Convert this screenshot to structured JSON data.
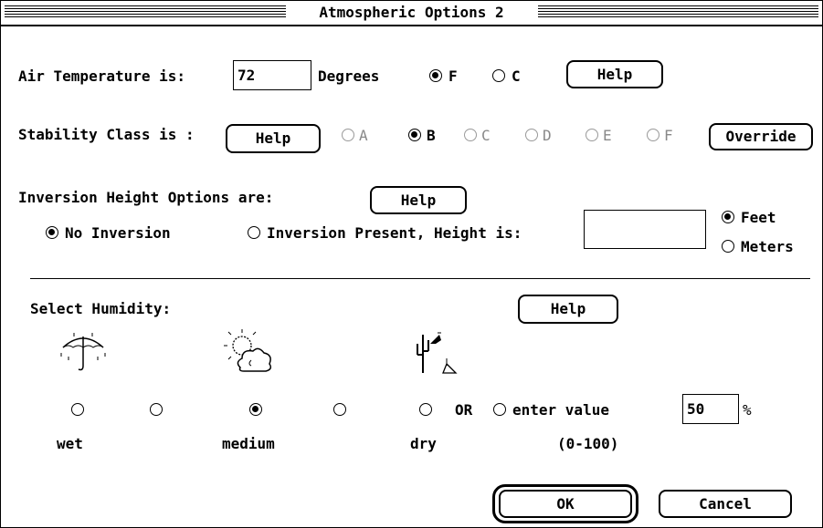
{
  "window": {
    "title": "Atmospheric Options 2"
  },
  "air_temperature": {
    "label": "Air Temperature is:",
    "value": "72",
    "units_label": "Degrees",
    "unit_options": [
      "F",
      "C"
    ],
    "selected_unit": "F",
    "help_label": "Help"
  },
  "stability": {
    "label": "Stability Class is :",
    "help_label": "Help",
    "classes": [
      "A",
      "B",
      "C",
      "D",
      "E",
      "F"
    ],
    "selected": "B",
    "override_label": "Override"
  },
  "inversion": {
    "label": "Inversion Height Options are:",
    "help_label": "Help",
    "no_inversion_label": "No Inversion",
    "present_label": "Inversion Present, Height is:",
    "selected": "No Inversion",
    "height_value": "",
    "unit_options": [
      "Feet",
      "Meters"
    ],
    "selected_unit": "Feet"
  },
  "humidity": {
    "label": "Select Humidity:",
    "help_label": "Help",
    "scale_labels": {
      "wet": "wet",
      "medium": "medium",
      "dry": "dry"
    },
    "selected_index": 2,
    "or_label": "OR",
    "enter_value_label": "enter value",
    "value": "50",
    "percent": "%",
    "range_label": "(0-100)",
    "icons": [
      "umbrella-rain-icon",
      "sun-cloud-icon",
      "cactus-dry-icon"
    ]
  },
  "buttons": {
    "ok": "OK",
    "cancel": "Cancel"
  }
}
